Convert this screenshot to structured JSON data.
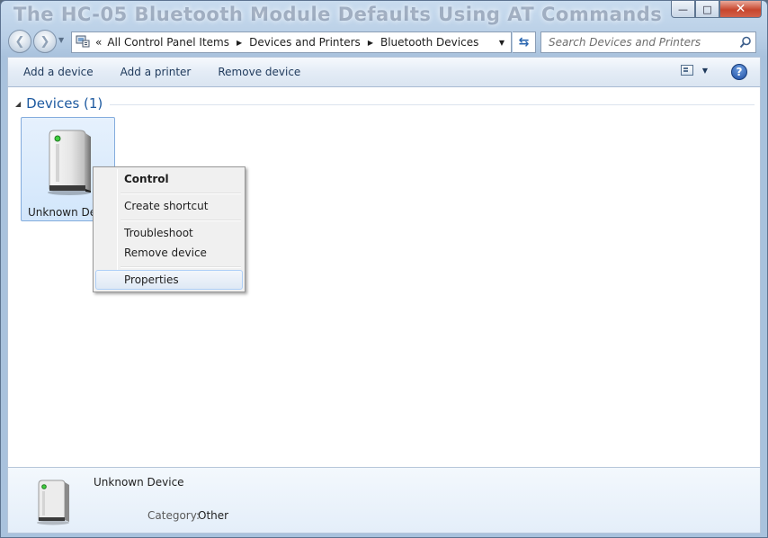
{
  "window": {
    "title": "The HC-05 Bluetooth Module Defaults Using AT Commands",
    "minimize_glyph": "—",
    "maximize_glyph": "□",
    "close_glyph": "✕"
  },
  "nav": {
    "back_glyph": "❮",
    "forward_glyph": "❯",
    "recent_glyph": "▼",
    "breadcrumb_chevron": "«",
    "breadcrumb": [
      "All Control Panel Items",
      "Devices and Printers",
      "Bluetooth Devices"
    ],
    "separator_glyph": "▶",
    "dropdown_glyph": "▼",
    "refresh_glyph": "⇆",
    "search_placeholder": "Search Devices and Printers"
  },
  "toolbar": {
    "buttons": [
      "Add a device",
      "Add a printer",
      "Remove device"
    ],
    "view_dropdown_glyph": "▼",
    "help_label": "?"
  },
  "content": {
    "group_arrow": "◢",
    "group_title": "Devices (1)",
    "device_label": "Unknown Device"
  },
  "context_menu": {
    "items": [
      "Control",
      "Create shortcut",
      "Troubleshoot",
      "Remove device",
      "Properties"
    ],
    "default_item": "Control",
    "highlighted_item": "Properties"
  },
  "details": {
    "name": "Unknown Device",
    "category_label": "Category:",
    "category_value": "Other"
  },
  "icons": {
    "device": "tower-device-icon",
    "address": "control-panel-icon",
    "search": "magnifier-icon",
    "view": "change-view-icon",
    "help": "help-icon"
  },
  "colors": {
    "accent_blue": "#1e5aa0",
    "selection_fill": "#d2e6fb",
    "selection_border": "#84acdd",
    "close_red": "#c7462e"
  }
}
